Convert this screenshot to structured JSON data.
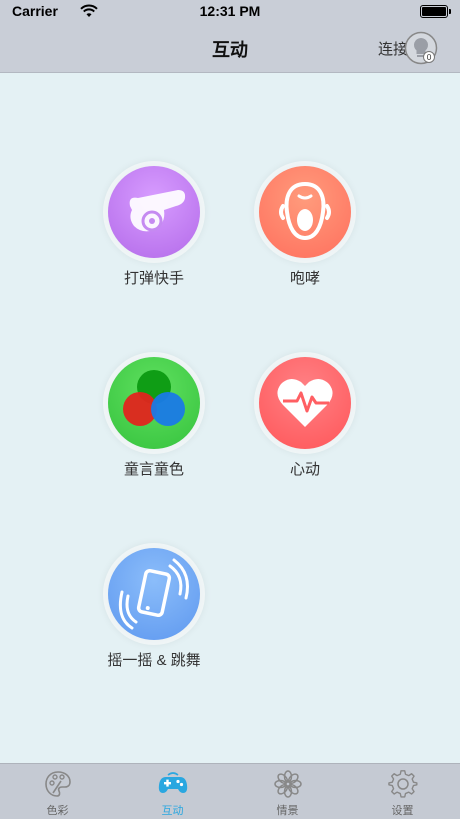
{
  "status_bar": {
    "carrier": "Carrier",
    "time": "12:31 PM"
  },
  "nav": {
    "title": "互动",
    "connect_label": "连接",
    "bulb_badge": "0"
  },
  "tiles": [
    {
      "label": "打弹快手",
      "icon": "cannon-icon",
      "color": "#c07ff0"
    },
    {
      "label": "咆哮",
      "icon": "shouting-face-icon",
      "color": "#ff7f68"
    },
    {
      "label": "童言童色",
      "icon": "color-circles-icon",
      "color": "#3fcd45"
    },
    {
      "label": "心动",
      "icon": "heartbeat-icon",
      "color": "#ff6266"
    },
    {
      "label": "摇一摇 & 跳舞",
      "icon": "shaking-phone-icon",
      "color": "#6fa7f4"
    }
  ],
  "tabs": [
    {
      "label": "色彩",
      "icon": "palette-icon",
      "active": false
    },
    {
      "label": "互动",
      "icon": "gamepad-icon",
      "active": true
    },
    {
      "label": "情景",
      "icon": "flower-icon",
      "active": false
    },
    {
      "label": "设置",
      "icon": "gear-icon",
      "active": false
    }
  ],
  "colors": {
    "active_tab": "#2aa7e0",
    "inactive_tab": "#888888",
    "bar_bg": "#c9ced7",
    "page_bg": "#e4f1f4"
  }
}
